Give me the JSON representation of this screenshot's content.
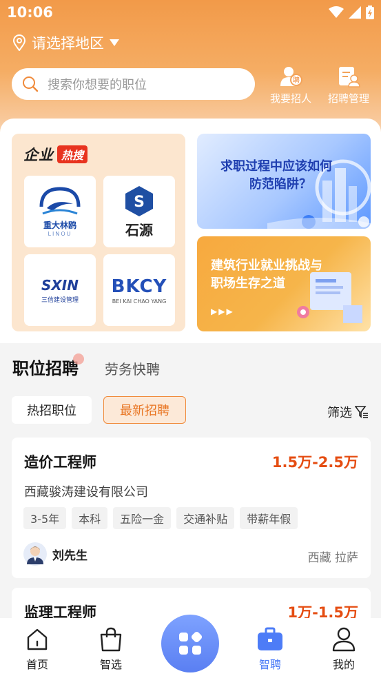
{
  "status": {
    "time": "10:06"
  },
  "location": {
    "label": "请选择地区"
  },
  "search": {
    "placeholder": "搜索你想要的职位"
  },
  "header_actions": [
    {
      "label": "我要招人",
      "badge": "聘"
    },
    {
      "label": "招聘管理"
    }
  ],
  "hot_companies": {
    "title": "企业",
    "badge": "热搜",
    "companies": [
      {
        "name": "重大林鸥",
        "sub": "LINOU"
      },
      {
        "name": "石源",
        "mark": "S"
      },
      {
        "name": "三信建设管理",
        "mark": "SXIN"
      },
      {
        "name": "BKCY",
        "sub": "BEI KAI CHAO YANG"
      }
    ]
  },
  "banners": [
    {
      "title_l1": "求职过程中应该如何",
      "title_l2": "防范陷阱？"
    },
    {
      "title_l1": "建筑行业就业挑战与",
      "title_l2": "职场生存之道",
      "arrows": "▶▶▶"
    }
  ],
  "tabs": {
    "active": "职位招聘",
    "other": "劳务快聘"
  },
  "chips": {
    "hot": "热招职位",
    "newest": "最新招聘"
  },
  "filter": {
    "label": "筛选"
  },
  "jobs": [
    {
      "title": "造价工程师",
      "salary": "1.5万-2.5万",
      "company": "西藏骏涛建设有限公司",
      "tags": [
        "3-5年",
        "本科",
        "五险一金",
        "交通补贴",
        "带薪年假"
      ],
      "recruiter": "刘先生",
      "location": "西藏 拉萨"
    },
    {
      "title": "监理工程师",
      "salary": "1万-1.5万"
    }
  ],
  "nav": [
    {
      "label": "首页"
    },
    {
      "label": "智选"
    },
    {
      "label": "智聘"
    },
    {
      "label": "我的"
    }
  ],
  "colors": {
    "accent": "#f29a49",
    "salary": "#e54d12",
    "nav_active": "#4d7cf7",
    "hot_badge": "#e8331f"
  }
}
